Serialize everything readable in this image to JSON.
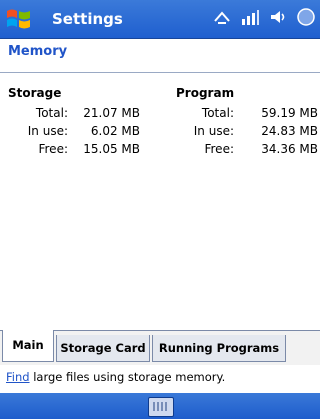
{
  "titlebar": {
    "title": "Settings"
  },
  "page": {
    "title": "Memory"
  },
  "storage": {
    "heading": "Storage",
    "rows": [
      {
        "label": "Total:",
        "value": "21.07 MB"
      },
      {
        "label": "In use:",
        "value": "6.02 MB"
      },
      {
        "label": "Free:",
        "value": "15.05 MB"
      }
    ]
  },
  "program": {
    "heading": "Program",
    "rows": [
      {
        "label": "Total:",
        "value": "59.19 MB"
      },
      {
        "label": "In use:",
        "value": "24.83 MB"
      },
      {
        "label": "Free:",
        "value": "34.36 MB"
      }
    ]
  },
  "tabs": [
    "Main",
    "Storage Card",
    "Running Programs"
  ],
  "hint": {
    "link": "Find",
    "text": " large files using storage memory."
  },
  "colors": {
    "titlebar": "#2a6bd6",
    "link": "#2054c8"
  }
}
